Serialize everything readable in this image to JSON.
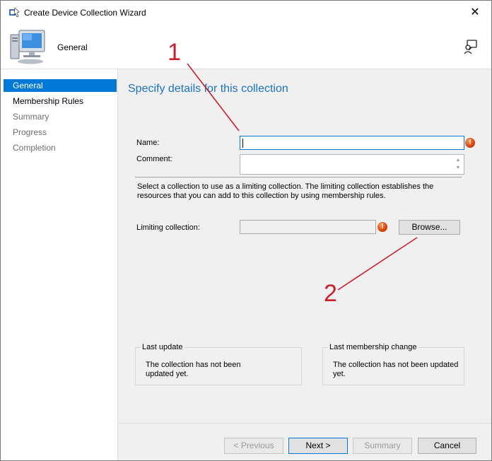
{
  "window": {
    "title": "Create Device Collection Wizard",
    "close_symbol": "✕"
  },
  "header": {
    "title": "General"
  },
  "sidebar": {
    "items": [
      {
        "label": "General",
        "state": "active"
      },
      {
        "label": "Membership Rules",
        "state": "enabled"
      },
      {
        "label": "Summary",
        "state": "disabled"
      },
      {
        "label": "Progress",
        "state": "disabled"
      },
      {
        "label": "Completion",
        "state": "disabled"
      }
    ]
  },
  "main": {
    "title": "Specify details for this collection",
    "name_label": "Name:",
    "name_value": "",
    "comment_label": "Comment:",
    "comment_value": "",
    "description": "Select a collection to use as a limiting collection. The limiting collection establishes the resources that you can add to this collection by using membership rules.",
    "limiting_label": "Limiting collection:",
    "limiting_value": "",
    "browse_label": "Browse...",
    "error_symbol": "!",
    "last_update": {
      "legend": "Last update",
      "text": "The collection has not been updated yet."
    },
    "last_membership": {
      "legend": "Last membership change",
      "text": "The collection has not been updated yet."
    }
  },
  "footer": {
    "previous_label": "< Previous",
    "next_label": "Next >",
    "summary_label": "Summary",
    "cancel_label": "Cancel"
  },
  "annotations": {
    "marker1": "1",
    "marker2": "2",
    "color": "#c8202c"
  },
  "colors": {
    "accent": "#0078d7",
    "title_blue": "#1e73be",
    "error": "#d9420b"
  }
}
